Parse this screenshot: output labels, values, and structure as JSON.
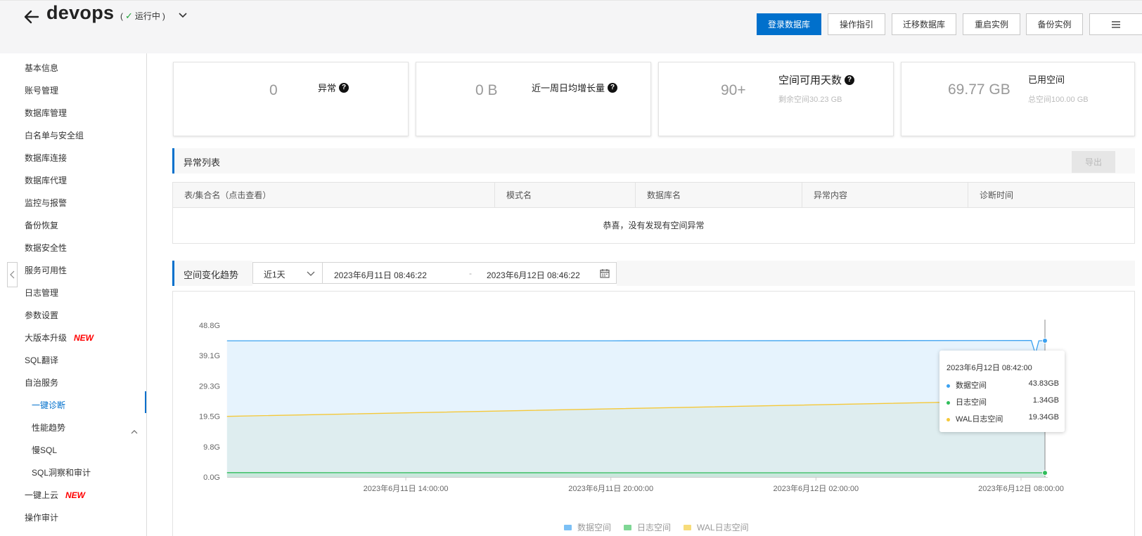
{
  "header": {
    "title": "devops",
    "status_open": "(",
    "status": "运行中",
    "status_close": ")",
    "buttons": {
      "login_db": "登录数据库",
      "guide": "操作指引",
      "migrate": "迁移数据库",
      "restart": "重启实例",
      "backup": "备份实例"
    },
    "more_icon": "list-icon"
  },
  "sidebar": {
    "items": [
      {
        "label": "基本信息"
      },
      {
        "label": "账号管理"
      },
      {
        "label": "数据库管理"
      },
      {
        "label": "白名单与安全组"
      },
      {
        "label": "数据库连接"
      },
      {
        "label": "数据库代理"
      },
      {
        "label": "监控与报警"
      },
      {
        "label": "备份恢复"
      },
      {
        "label": "数据安全性"
      },
      {
        "label": "服务可用性"
      },
      {
        "label": "日志管理"
      },
      {
        "label": "参数设置"
      },
      {
        "label": "大版本升级",
        "badge": "NEW"
      },
      {
        "label": "SQL翻译"
      },
      {
        "label": "自治服务"
      },
      {
        "label": "一键诊断",
        "active": true
      },
      {
        "label": "性能趋势"
      },
      {
        "label": "慢SQL"
      },
      {
        "label": "SQL洞察和审计"
      },
      {
        "label": "一键上云",
        "badge": "NEW"
      },
      {
        "label": "操作审计"
      }
    ]
  },
  "cards": [
    {
      "value": "0",
      "label": "异常",
      "help": "?"
    },
    {
      "value": "0 B",
      "label": "近一周日均增长量",
      "help": "?"
    },
    {
      "value": "90+",
      "label": "空间可用天数",
      "help": "?",
      "sub": "剩余空间30.23 GB"
    },
    {
      "value": "69.77 GB",
      "label": "已用空间",
      "sub": "总空间100.00 GB"
    }
  ],
  "anomaly": {
    "title": "异常列表",
    "export": "导出",
    "columns": [
      "表/集合名（点击查看）",
      "模式名",
      "数据库名",
      "异常内容",
      "诊断时间"
    ],
    "empty": "恭喜，没有发现有空间异常"
  },
  "trend": {
    "title": "空间变化趋势",
    "range": "近1天",
    "start": "2023年6月11日 08:46:22",
    "separator": "-",
    "end": "2023年6月12日 08:46:22"
  },
  "tooltip": {
    "time": "2023年6月12日 08:42:00",
    "rows": [
      {
        "name": "数据空间",
        "value": "43.83GB"
      },
      {
        "name": "日志空间",
        "value": "1.34GB"
      },
      {
        "name": "WAL日志空间",
        "value": "19.34GB"
      }
    ]
  },
  "colors": {
    "accent": "#0070cc",
    "data": "#3ba1f0",
    "log": "#2fbd5a",
    "wal": "#f5c838"
  },
  "chart_data": {
    "type": "area",
    "x_ticks": [
      "2023年6月11日 14:00:00",
      "2023年6月11日 20:00:00",
      "2023年6月12日 02:00:00",
      "2023年6月12日 08:00:00"
    ],
    "y_ticks": [
      "0.0G",
      "9.8G",
      "19.5G",
      "29.3G",
      "39.1G",
      "48.8G"
    ],
    "ylim": [
      0,
      48.8
    ],
    "x_start_hours": 8.7733,
    "x_end_hours": 32.7,
    "series": [
      {
        "name": "数据空间",
        "color": "#3ba1f0",
        "points": [
          [
            8.77,
            43.8
          ],
          [
            20,
            43.8
          ],
          [
            32.3,
            43.9
          ],
          [
            32.42,
            39.6
          ],
          [
            32.52,
            43.8
          ],
          [
            32.7,
            43.83
          ]
        ]
      },
      {
        "name": "日志空间",
        "color": "#2fbd5a",
        "points": [
          [
            8.77,
            1.4
          ],
          [
            20,
            1.35
          ],
          [
            32.6,
            1.35
          ],
          [
            32.7,
            1.34
          ]
        ]
      },
      {
        "name": "WAL日志空间",
        "color": "#f5c838",
        "points": [
          [
            8.77,
            19.5
          ],
          [
            32.42,
            24.6
          ],
          [
            32.55,
            24.5
          ],
          [
            32.7,
            19.34
          ]
        ]
      }
    ],
    "legend": [
      "数据空间",
      "日志空间",
      "WAL日志空间"
    ],
    "legend_placement": "bottom-center"
  }
}
